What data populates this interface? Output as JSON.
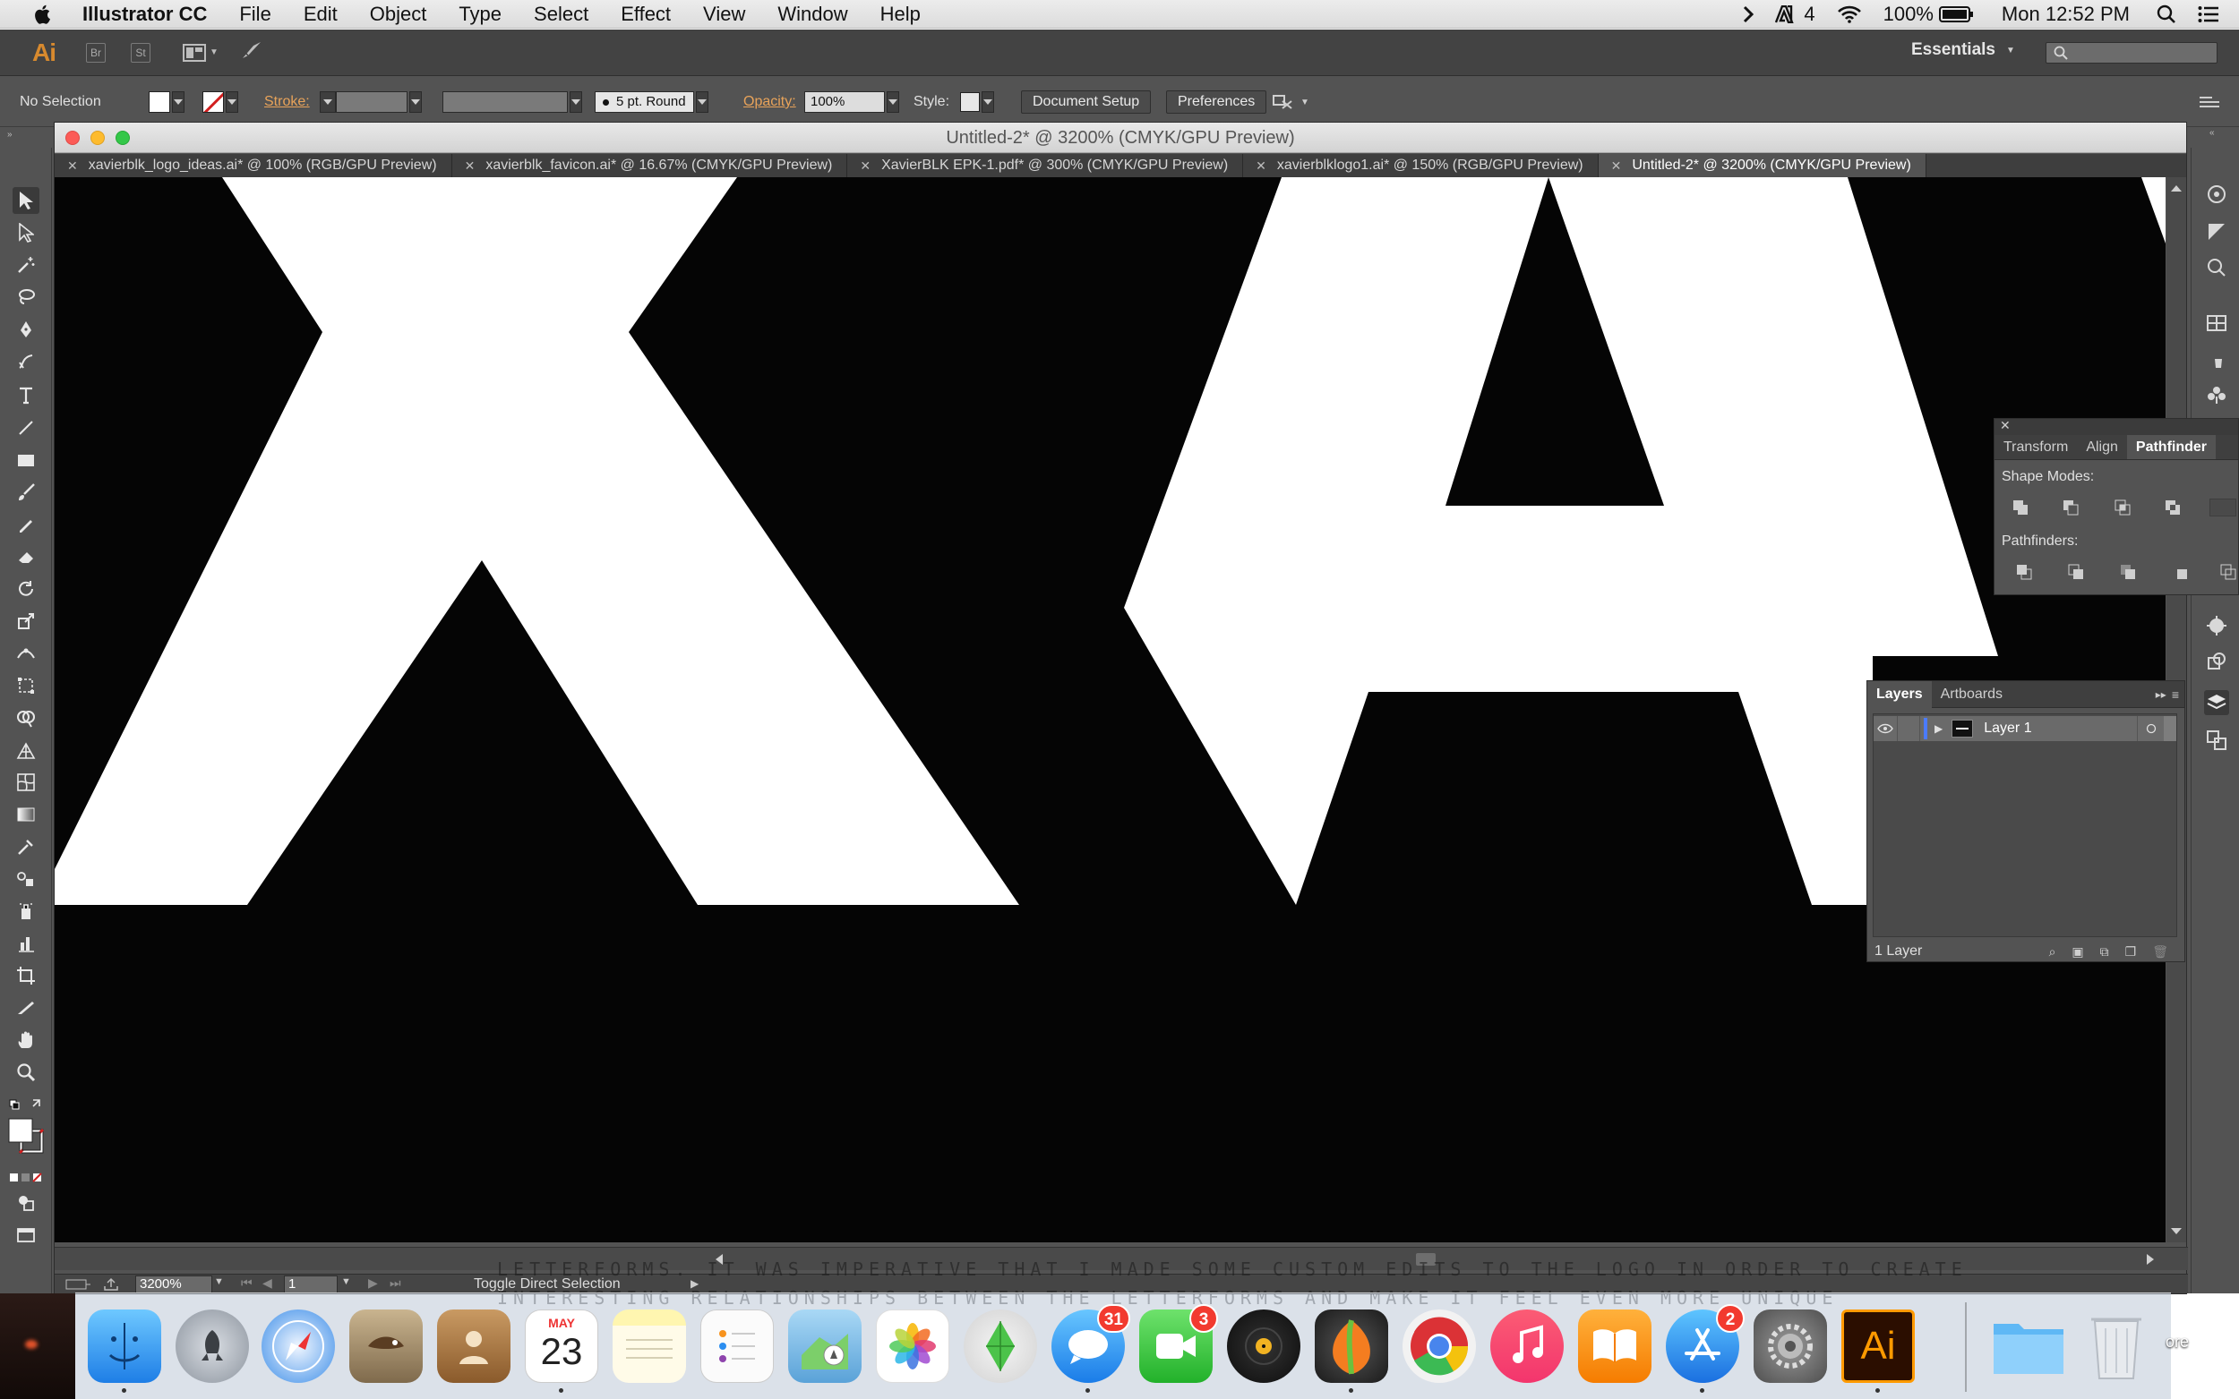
{
  "menubar": {
    "app_name": "Illustrator CC",
    "items": [
      "File",
      "Edit",
      "Object",
      "Type",
      "Select",
      "Effect",
      "View",
      "Window",
      "Help"
    ],
    "adobe_count": "4",
    "battery": "100%",
    "clock": "Mon 12:52 PM"
  },
  "appbar": {
    "logo": "Ai",
    "bridge": "Br",
    "stock": "St",
    "workspace": "Essentials"
  },
  "controlbar": {
    "selection": "No Selection",
    "stroke_label": "Stroke:",
    "brush": "5 pt. Round",
    "opacity_label": "Opacity:",
    "opacity_value": "100%",
    "style_label": "Style:",
    "document_setup": "Document Setup",
    "preferences": "Preferences"
  },
  "document": {
    "title": "Untitled-2* @ 3200% (CMYK/GPU Preview)",
    "tabs": [
      {
        "label": "xavierblk_logo_ideas.ai* @ 100% (RGB/GPU Preview)",
        "active": false
      },
      {
        "label": "xavierblk_favicon.ai* @ 16.67% (CMYK/GPU Preview)",
        "active": false
      },
      {
        "label": "XavierBLK EPK-1.pdf* @ 300% (CMYK/GPU Preview)",
        "active": false
      },
      {
        "label": "xavierblklogo1.ai* @ 150% (RGB/GPU Preview)",
        "active": false
      },
      {
        "label": "Untitled-2* @ 3200% (CMYK/GPU Preview)",
        "active": true
      }
    ]
  },
  "statusbar": {
    "zoom": "3200%",
    "artboard": "1",
    "status": "Toggle Direct Selection"
  },
  "pathfinder": {
    "tabs": [
      "Transform",
      "Align",
      "Pathfinder"
    ],
    "active_tab": "Pathfinder",
    "shape_modes": "Shape Modes:",
    "pathfinders": "Pathfinders:"
  },
  "layers": {
    "tabs": [
      "Layers",
      "Artboards"
    ],
    "active_tab": "Layers",
    "layer_name": "Layer 1",
    "count": "1 Layer"
  },
  "background_text": {
    "line1": "LETTERFORMS. IT WAS IMPERATIVE THAT I MADE SOME CUSTOM EDITS TO THE LOGO IN ORDER TO CREATE",
    "line2": "INTERESTING RELATIONSHIPS BETWEEN THE LETTERFORMS AND MAKE IT FEEL EVEN MORE UNIQUE"
  },
  "dock": {
    "calendar_month": "MAY",
    "calendar_day": "23",
    "messages_badge": "31",
    "facetime_badge": "3",
    "appstore_badge": "2",
    "ai_label": "Ai",
    "edge_text": "ore"
  },
  "colors": {
    "ai_orange": "#d88a2e",
    "canvas_black": "#050505",
    "panel_gray": "#535353"
  }
}
